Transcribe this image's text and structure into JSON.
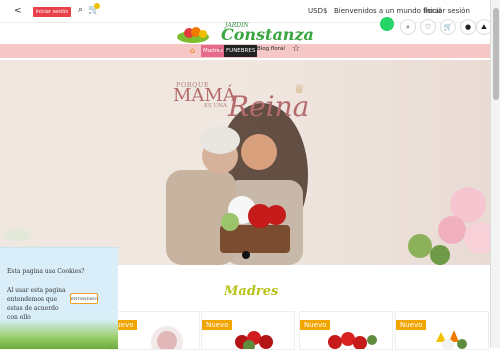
{
  "topbar": {
    "lang": "<",
    "share_label": "Iniciar sesión",
    "currency": "USD$",
    "welcome": "Bienvenidos a un mundo floral",
    "login": "Iniciar sesión"
  },
  "logo": {
    "jardin": "JARDIN",
    "name": "Constanza"
  },
  "nav": {
    "madres": "Madres",
    "funebres": "FUNEBRES",
    "blog": "Blog floral"
  },
  "hero": {
    "porque": "PORQUE",
    "mama": "MAMÁ",
    "es_una": "ES UNA",
    "reina": "Reina"
  },
  "section": {
    "title": "Madres"
  },
  "products": [
    {
      "badge": "Nuevo"
    },
    {
      "badge": "Nuevo"
    },
    {
      "badge": "Nuevo"
    },
    {
      "badge": "Nuevo"
    }
  ],
  "cookie": {
    "title": "Esta pagina usa Cookies?",
    "message": "Al usar esta pagina entendemos que estas de acuerdo con ello",
    "button": "ENTENDIDO"
  },
  "colors": {
    "nav_bg": "#f6c7c7",
    "accent_pink": "#e66b8a",
    "brand_green": "#3aa640",
    "section_title": "#b7c21a",
    "badge": "#f1a500"
  }
}
